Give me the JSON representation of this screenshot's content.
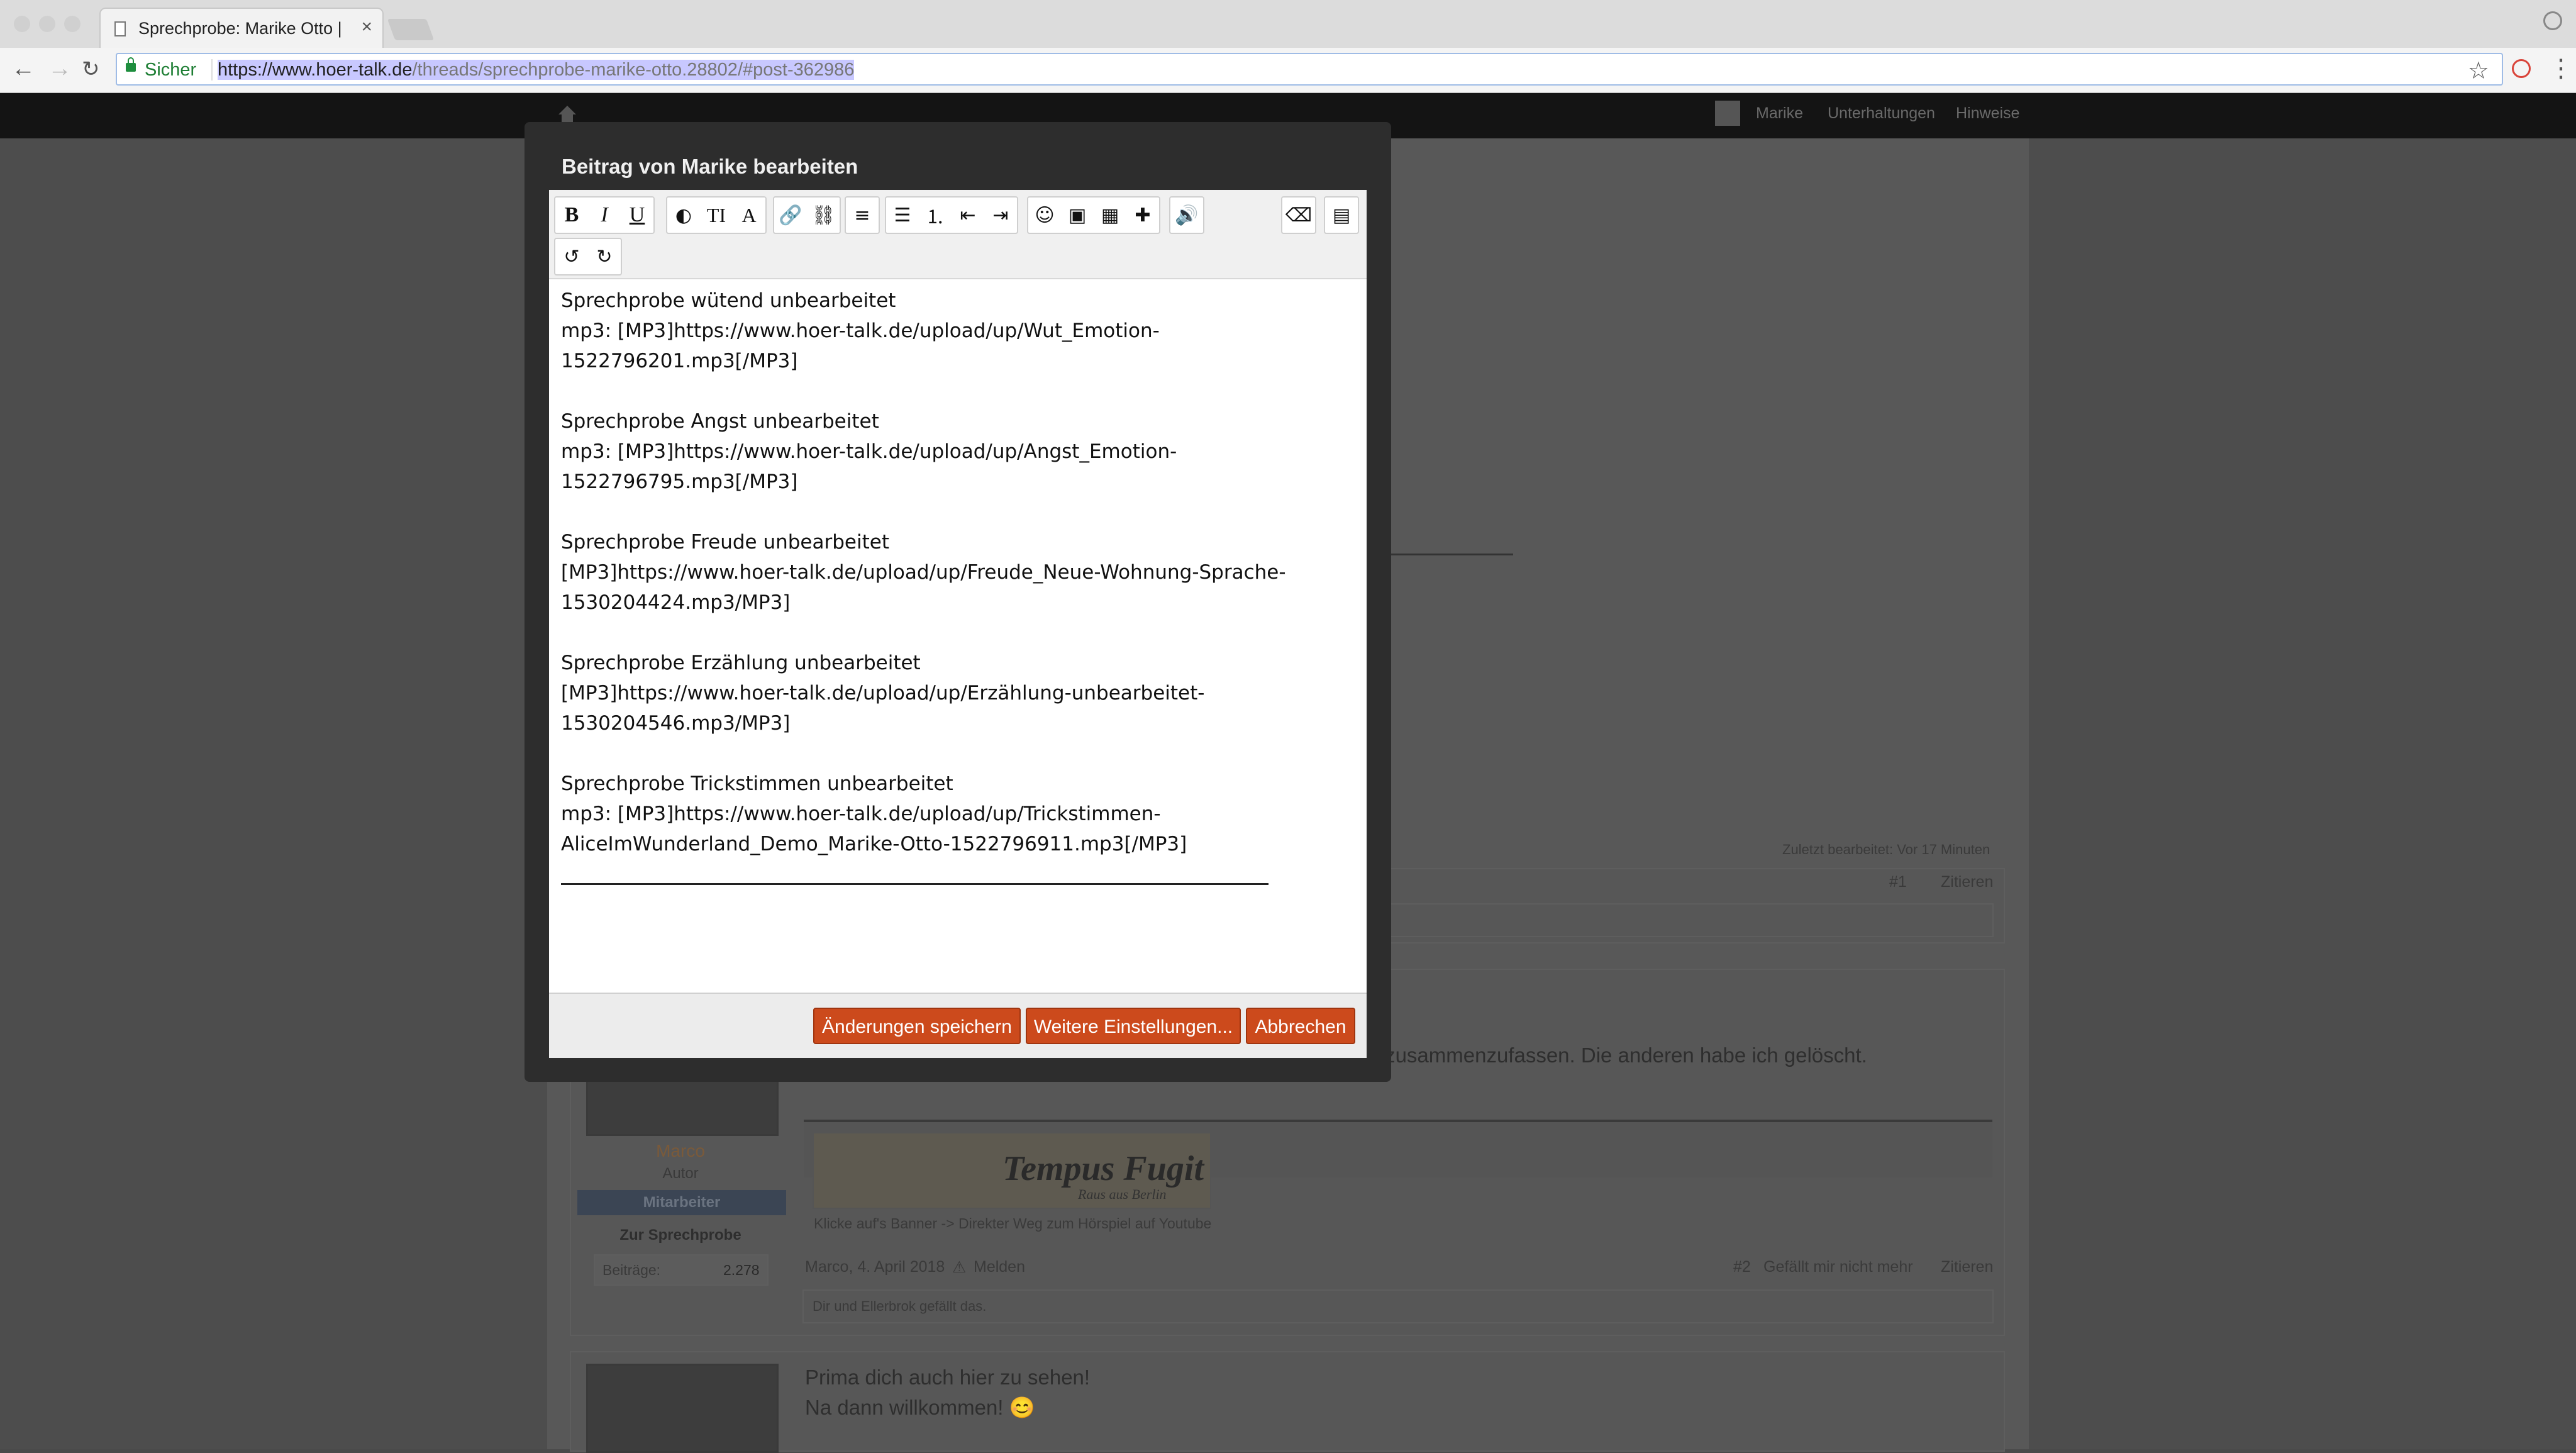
{
  "browser": {
    "tab_title": "Sprechprobe: Marike Otto | Ho",
    "tab_close": "×",
    "secure_label": "Sicher",
    "url_host": "https://www.hoer-talk.de",
    "url_path": "/threads/sprechprobe-marike-otto.28802/#post-362986",
    "icons": [
      "back-icon",
      "forward-icon",
      "reload-icon",
      "lock-icon",
      "star-icon",
      "profile-icon",
      "menu-icon"
    ]
  },
  "site_header": {
    "user_name": "Marike",
    "nav": [
      "Unterhaltungen",
      "Hinweise"
    ]
  },
  "background_page": {
    "last_edited": "Zuletzt bearbeitet: Vor 17 Minuten",
    "post1_number": "#1",
    "quote_label": "Zitieren",
    "post2_text": "Ich habe mir erlaubt Deine Sprechproben mal in einem Thread zusammenzufassen. Die anderen habe ich gelöscht.",
    "post2_author_name": "Marco",
    "post2_author_title": "Autor",
    "post2_author_badge": "Mitarbeiter",
    "post2_author_link": "Zur Sprechprobe",
    "post2_author_posts_label": "Beiträge:",
    "post2_author_posts_value": "2.278",
    "banner_title": "Tempus Fugit",
    "banner_sub": "Raus aus Berlin",
    "banner_caption": "Klicke auf's Banner -> Direkter Weg zum Hörspiel auf Youtube",
    "post2_meta": "Marco, 4. April 2018",
    "report_label": "Melden",
    "post2_number": "#2",
    "unlike_label": "Gefällt mir nicht mehr",
    "likes_text": "Dir und Ellerbrok gefällt das.",
    "post3_line1": "Prima dich auch hier zu sehen!",
    "post3_line2": "Na dann willkommen! 😊"
  },
  "modal": {
    "title": "Beitrag von Marike bearbeiten",
    "toolbar_icons": [
      "bold-icon",
      "italic-icon",
      "underline-icon",
      "color-icon",
      "font-size-icon",
      "font-family-icon",
      "link-icon",
      "unlink-icon",
      "align-icon",
      "bullet-list-icon",
      "numbered-list-icon",
      "outdent-icon",
      "indent-icon",
      "smiley-icon",
      "image-icon",
      "media-icon",
      "insert-more-icon",
      "audio-icon",
      "remove-format-icon",
      "toggle-source-icon",
      "undo-icon",
      "redo-icon"
    ],
    "content": [
      {
        "title": "Sprechprobe wütend unbearbeitet",
        "line": "mp3: [MP3]https://www.hoer-talk.de/upload/up/Wut_Emotion-",
        "line2": "1522796201.mp3[/MP3]"
      },
      {
        "title": "Sprechprobe Angst unbearbeitet",
        "line": "mp3: [MP3]https://www.hoer-talk.de/upload/up/Angst_Emotion-",
        "line2": "1522796795.mp3[/MP3]"
      },
      {
        "title": "Sprechprobe Freude unbearbeitet",
        "line": "[MP3]https://www.hoer-talk.de/upload/up/Freude_Neue-Wohnung-Sprache-",
        "line2": "1530204424.mp3/MP3]"
      },
      {
        "title": "Sprechprobe Erzählung unbearbeitet",
        "line": "[MP3]https://www.hoer-talk.de/upload/up/Erzählung-unbearbeitet-",
        "line2": "1530204546.mp3/MP3]"
      },
      {
        "title": "Sprechprobe Trickstimmen unbearbeitet",
        "line": "mp3: [MP3]https://www.hoer-talk.de/upload/up/Trickstimmen-",
        "line2": "AliceImWunderland_Demo_Marike-Otto-1522796911.mp3[/MP3]"
      }
    ],
    "buttons": {
      "save": "Änderungen speichern",
      "more": "Weitere Einstellungen...",
      "cancel": "Abbrechen"
    },
    "accent_color": "#cc4a1c"
  }
}
